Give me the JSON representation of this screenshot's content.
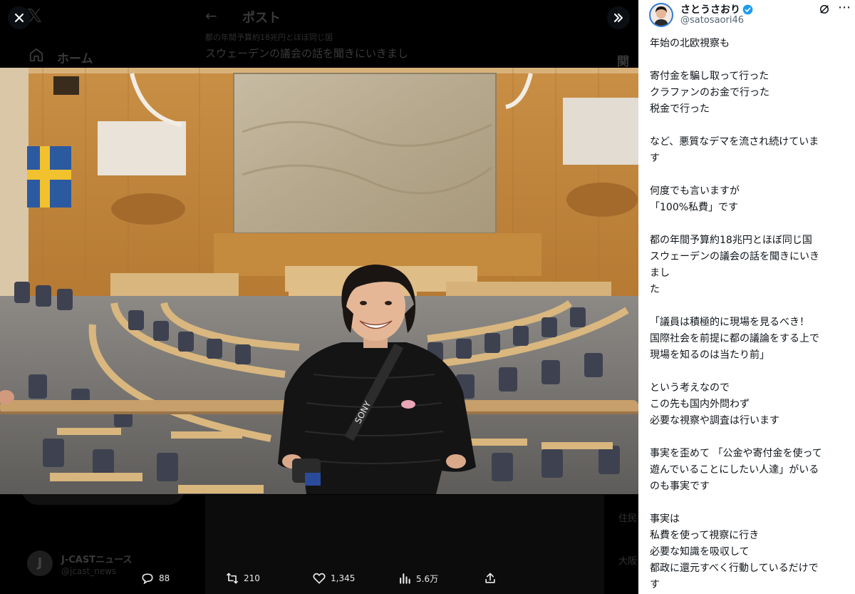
{
  "background": {
    "logo": "𝕏",
    "nav_home": "ホーム",
    "post_header_title": "ポスト",
    "post_meta_line": "都の年間予算約18兆円とほぼ同じ国",
    "post_preview_line": "スウェーデンの議会の話を聞きにいきまし",
    "related_header": "関連",
    "card_name": "J-CASTニュース",
    "card_handle": "@jcast_news",
    "card_avatar_letter": "J",
    "right_snippet_a": "住民",
    "right_snippet_b": "大阪"
  },
  "viewer": {
    "close_icon": "close-icon",
    "expand_icon": "chevron-double-right-icon"
  },
  "actions": {
    "replies": "88",
    "reposts": "210",
    "likes": "1,345",
    "views": "5.6万"
  },
  "post": {
    "author_name": "さとうさおり",
    "author_handle": "@satosaori46",
    "lines": [
      "年始の北欧視察も",
      "",
      "寄付金を騙し取って行った",
      "クラファンのお金で行った",
      "税金で行った",
      "",
      "など、悪質なデマを流され続けていま",
      "す",
      "",
      "何度でも言いますが",
      "「100%私費」です",
      "",
      "都の年間予算約18兆円とほぼ同じ国",
      "スウェーデンの議会の話を聞きにいき",
      "まし",
      "た",
      "",
      "「議員は積極的に現場を見るべき！",
      "国際社会を前提に都の議論をする上で",
      "現場を知るのは当たり前」",
      "",
      "という考えなので",
      "この先も国内外問わず",
      "必要な視察や調査は行います",
      "",
      "事実を歪めて 「公金や寄付金を使って",
      "遊んでいることにしたい人達」がいる",
      "のも事実です",
      "",
      "事実は",
      "私費を使って視察に行き",
      "必要な知識を吸収して",
      "都政に還元すべく行動しているだけで",
      "す"
    ]
  },
  "colors": {
    "verified_blue": "#1d9bf0",
    "panel_bg": "#ffffff",
    "viewer_bg": "#000000"
  }
}
